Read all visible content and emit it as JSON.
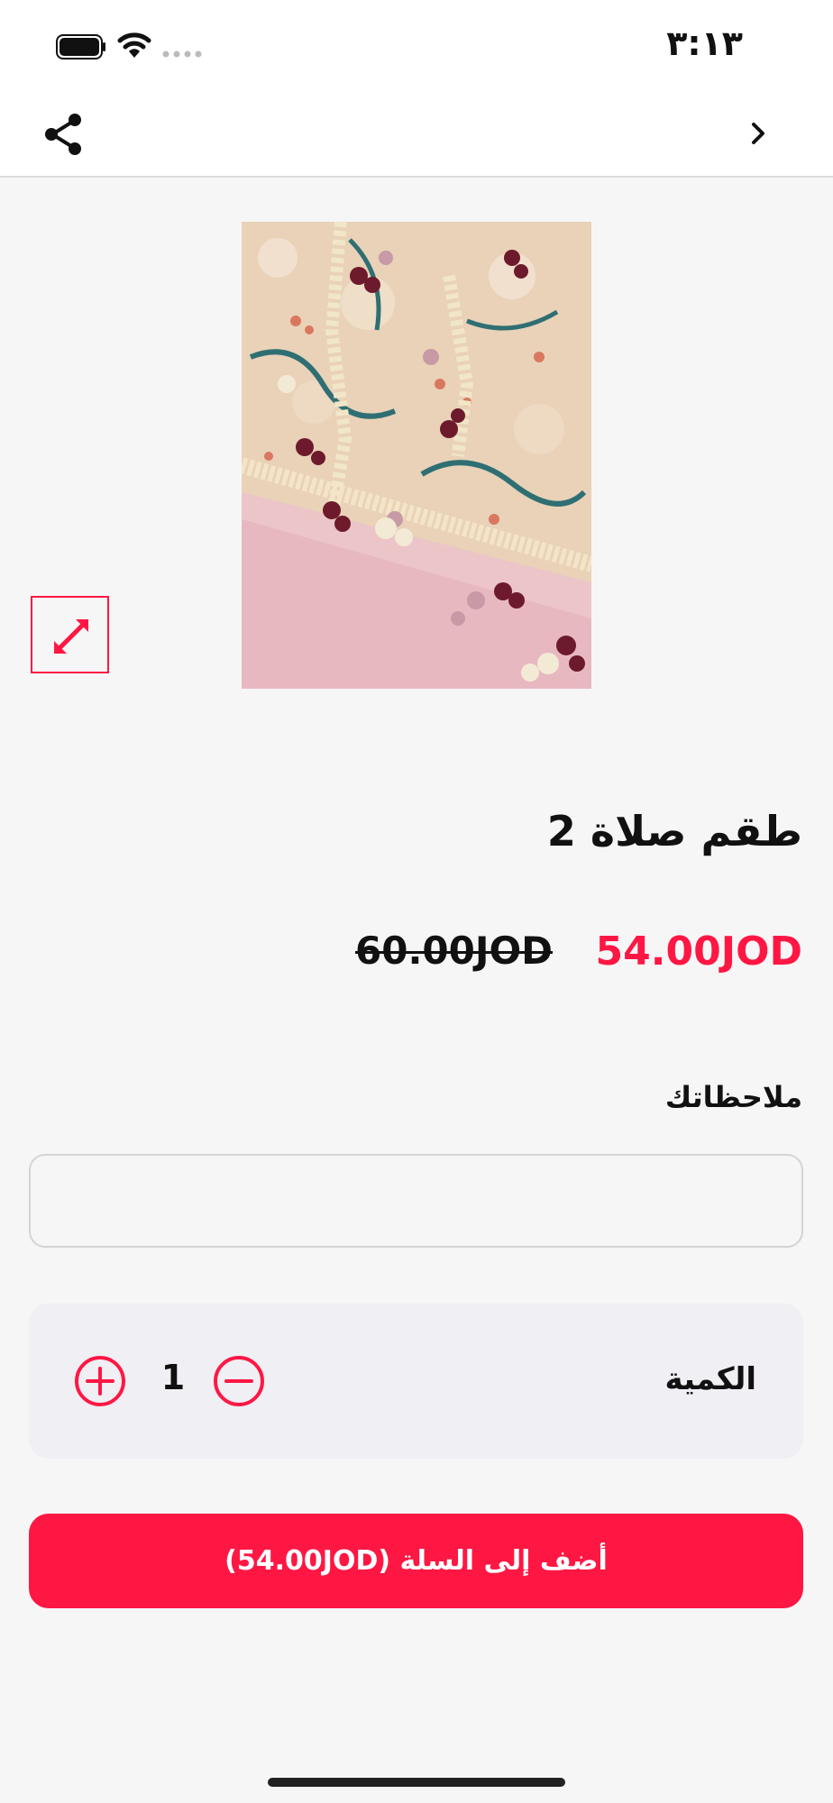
{
  "status_bar": {
    "time": "٣:١٣"
  },
  "icons": {
    "share": "share-icon",
    "back": "chevron-right-icon",
    "expand": "expand-arrows-icon",
    "plus": "plus-circle-icon",
    "minus": "minus-circle-icon"
  },
  "product": {
    "title": "طقم صلاة 2",
    "price_current": "54.00JOD",
    "price_old": "60.00JOD"
  },
  "notes": {
    "label": "ملاحظاتك",
    "value": "",
    "placeholder": ""
  },
  "quantity": {
    "label": "الكمية",
    "value": "1"
  },
  "cart": {
    "button_label": "أضف إلى السلة (54.00JOD)"
  },
  "colors": {
    "accent": "#ff1744",
    "background": "#f6f6f7",
    "card": "#efeff4"
  }
}
